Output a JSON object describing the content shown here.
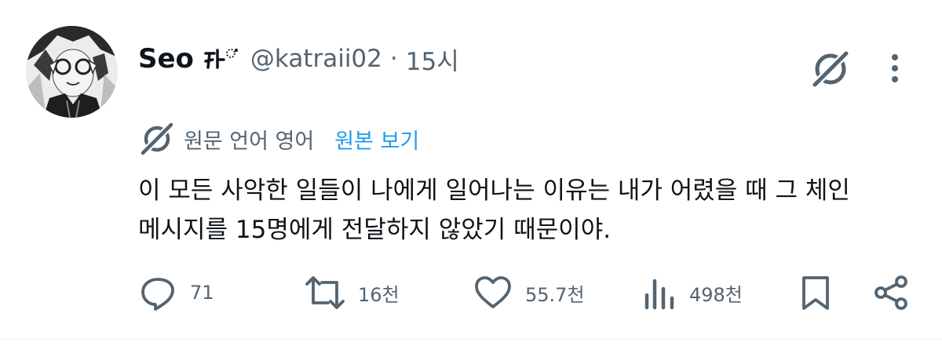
{
  "tweet": {
    "author": {
      "display_name": "Seo",
      "handle": "@katraii02",
      "time": "15시",
      "separator": "·"
    },
    "translation": {
      "label": "원문 언어 영어",
      "view_original": "원본 보기"
    },
    "text": {
      "line1": "이 모든 사악한 일들이 나에게 일어나는 이유는 내가 어렸을 때 그 체인",
      "line2": "메시지를 15명에게 전달하지 않았기 때문이야."
    },
    "actions": {
      "replies": "71",
      "retweets": "16천",
      "likes": "55.7천",
      "views": "498천"
    }
  },
  "icons": {
    "grok": "grok-icon",
    "more": "more-icon",
    "translate": "translate-icon",
    "reply": "reply-icon",
    "retweet": "retweet-icon",
    "like": "heart-icon",
    "views": "views-icon",
    "bookmark": "bookmark-icon",
    "share": "share-icon"
  },
  "colors": {
    "text": "#0f1419",
    "secondary": "#536471",
    "link": "#1d9bf0"
  }
}
